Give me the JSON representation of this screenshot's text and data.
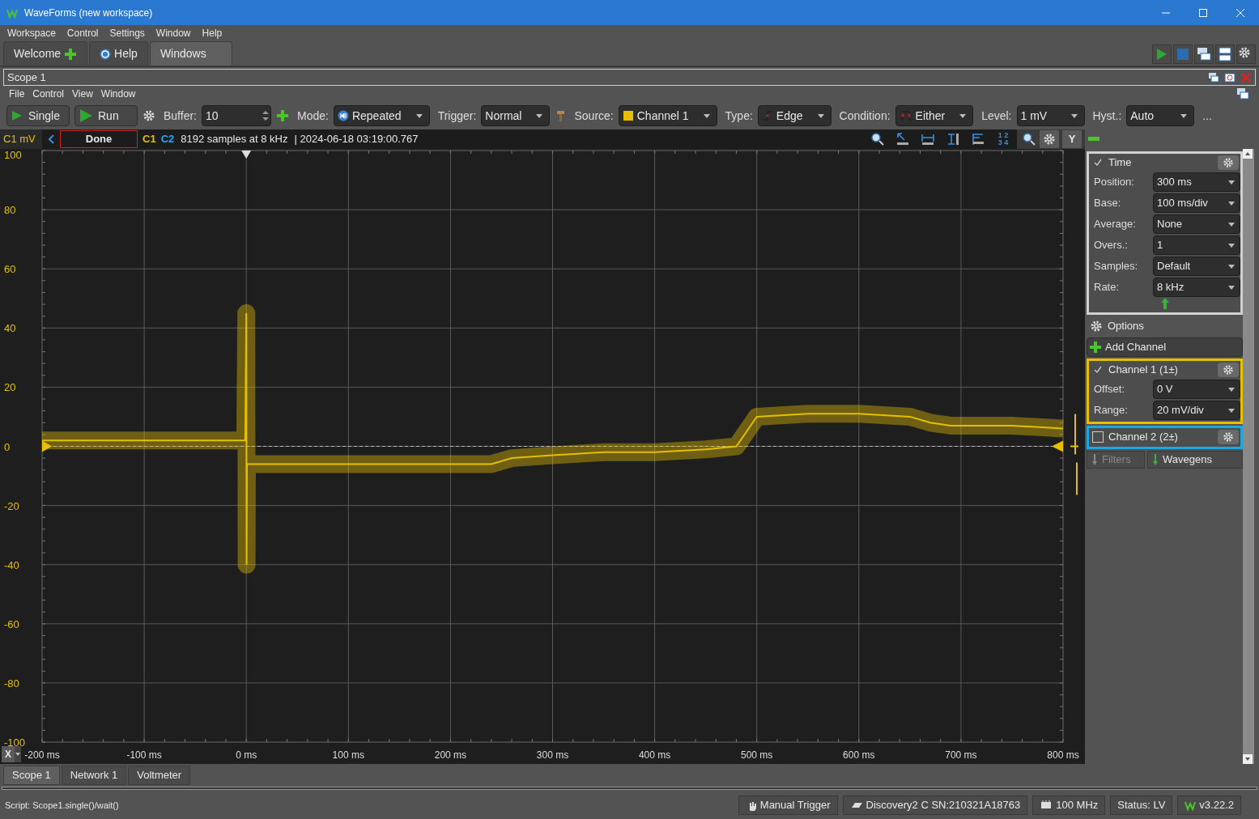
{
  "window": {
    "title": "WaveForms (new workspace)"
  },
  "menu": [
    "Workspace",
    "Control",
    "Settings",
    "Window",
    "Help"
  ],
  "tabs": [
    {
      "label": "Welcome",
      "selected": false
    },
    {
      "label": "Help",
      "selected": false
    },
    {
      "label": "Windows",
      "selected": true
    }
  ],
  "scope": {
    "title": "Scope 1",
    "menu": [
      "File",
      "Control",
      "View",
      "Window"
    ],
    "toolbar": [
      {
        "kind": "button",
        "label": "Single"
      },
      {
        "kind": "button",
        "label": "Run"
      },
      {
        "kind": "icon"
      },
      {
        "kind": "label",
        "text": "Buffer:"
      },
      {
        "kind": "spin",
        "value": "10"
      },
      {
        "kind": "icon"
      },
      {
        "kind": "label",
        "text": "Mode:"
      },
      {
        "kind": "select",
        "value": "Repeated"
      },
      {
        "kind": "label",
        "text": "Trigger:"
      },
      {
        "kind": "select",
        "value": "Normal"
      },
      {
        "kind": "icon"
      },
      {
        "kind": "label",
        "text": "Source:"
      },
      {
        "kind": "select",
        "value": "Channel 1",
        "color": "#e6c000"
      },
      {
        "kind": "label",
        "text": "Type:"
      },
      {
        "kind": "select",
        "value": "Edge"
      },
      {
        "kind": "label",
        "text": "Condition:"
      },
      {
        "kind": "select",
        "value": "Either"
      },
      {
        "kind": "label",
        "text": "Level:"
      },
      {
        "kind": "select",
        "value": "1 mV"
      },
      {
        "kind": "label",
        "text": "Hyst.:"
      },
      {
        "kind": "select",
        "value": "Auto"
      },
      {
        "kind": "label",
        "text": "..."
      }
    ],
    "strip": {
      "unit": "C1 mV",
      "state": "Done",
      "channels": [
        {
          "label": "C1",
          "color": "#e6c000"
        },
        {
          "label": "C2",
          "color": "#22aaee"
        }
      ],
      "info": "8192 samples at 8 kHz",
      "timestamp": "| 2024-06-18 03:19:00.767",
      "grid_digits": "1 2 3 4",
      "y_button": "Y"
    },
    "plot": {
      "x_button": "X",
      "chart_data": {
        "type": "line",
        "grid": true,
        "ref_lines": [
          {
            "axis": "y",
            "value": 0
          }
        ],
        "xlim": [
          -200,
          800
        ],
        "ylim": [
          -100,
          100
        ],
        "xticks": [
          {
            "value": -200,
            "label": "-200 ms"
          },
          {
            "value": -100,
            "label": "-100 ms"
          },
          {
            "value": 0,
            "label": "0 ms"
          },
          {
            "value": 100,
            "label": "100 ms"
          },
          {
            "value": 200,
            "label": "200 ms"
          },
          {
            "value": 300,
            "label": "300 ms"
          },
          {
            "value": 400,
            "label": "400 ms"
          },
          {
            "value": 500,
            "label": "500 ms"
          },
          {
            "value": 600,
            "label": "600 ms"
          },
          {
            "value": 700,
            "label": "700 ms"
          },
          {
            "value": 800,
            "label": "800 ms"
          }
        ],
        "yticks": [
          100,
          80,
          60,
          40,
          20,
          0,
          -20,
          -40,
          -60,
          -80,
          -100
        ],
        "x": [
          -200,
          -100,
          -1,
          0,
          0.3,
          0.6,
          50,
          100,
          150,
          200,
          240,
          260,
          300,
          350,
          400,
          450,
          480,
          490,
          500,
          550,
          600,
          650,
          670,
          690,
          750,
          800
        ],
        "series": [
          {
            "color": "#e6c000",
            "values": [
              2,
              2,
              2,
              45,
              -40,
              -6,
              -6,
              -6,
              -6,
              -6,
              -6,
              -4,
              -3,
              -2,
              -2,
              -1,
              0,
              5,
              10,
              11,
              11,
              10,
              8,
              7,
              7,
              6
            ]
          }
        ]
      }
    },
    "panel": {
      "time": {
        "title": "Time",
        "checked": true,
        "fields": [
          {
            "label": "Position:",
            "value": "300 ms"
          },
          {
            "label": "Base:",
            "value": "100 ms/div"
          },
          {
            "label": "Average:",
            "value": "None"
          },
          {
            "label": "Overs.:",
            "value": "1"
          },
          {
            "label": "Samples:",
            "value": "Default"
          },
          {
            "label": "Rate:",
            "value": "8 kHz"
          }
        ]
      },
      "options": "Options",
      "add_channel": "Add Channel",
      "channels": [
        {
          "title": "Channel 1 (1±)",
          "checked": true,
          "color": "#e6c000",
          "fields": [
            {
              "label": "Offset:",
              "value": "0 V"
            },
            {
              "label": "Range:",
              "value": "20 mV/div"
            }
          ]
        },
        {
          "title": "Channel 2 (2±)",
          "checked": false,
          "color": "#1aa8e0"
        }
      ],
      "buttons": [
        {
          "label": "Filters",
          "disabled": true
        },
        {
          "label": "Wavegens",
          "disabled": false
        }
      ]
    }
  },
  "bottom_tabs": [
    {
      "label": "Scope 1",
      "selected": true
    },
    {
      "label": "Network 1",
      "selected": false
    },
    {
      "label": "Voltmeter",
      "selected": false
    }
  ],
  "status_bar": {
    "script": "Script: Scope1.single()/wait()",
    "items": [
      "Manual Trigger",
      "Discovery2 C SN:210321A18763",
      "100 MHz",
      "Status: LV",
      "v3.22.2"
    ]
  }
}
